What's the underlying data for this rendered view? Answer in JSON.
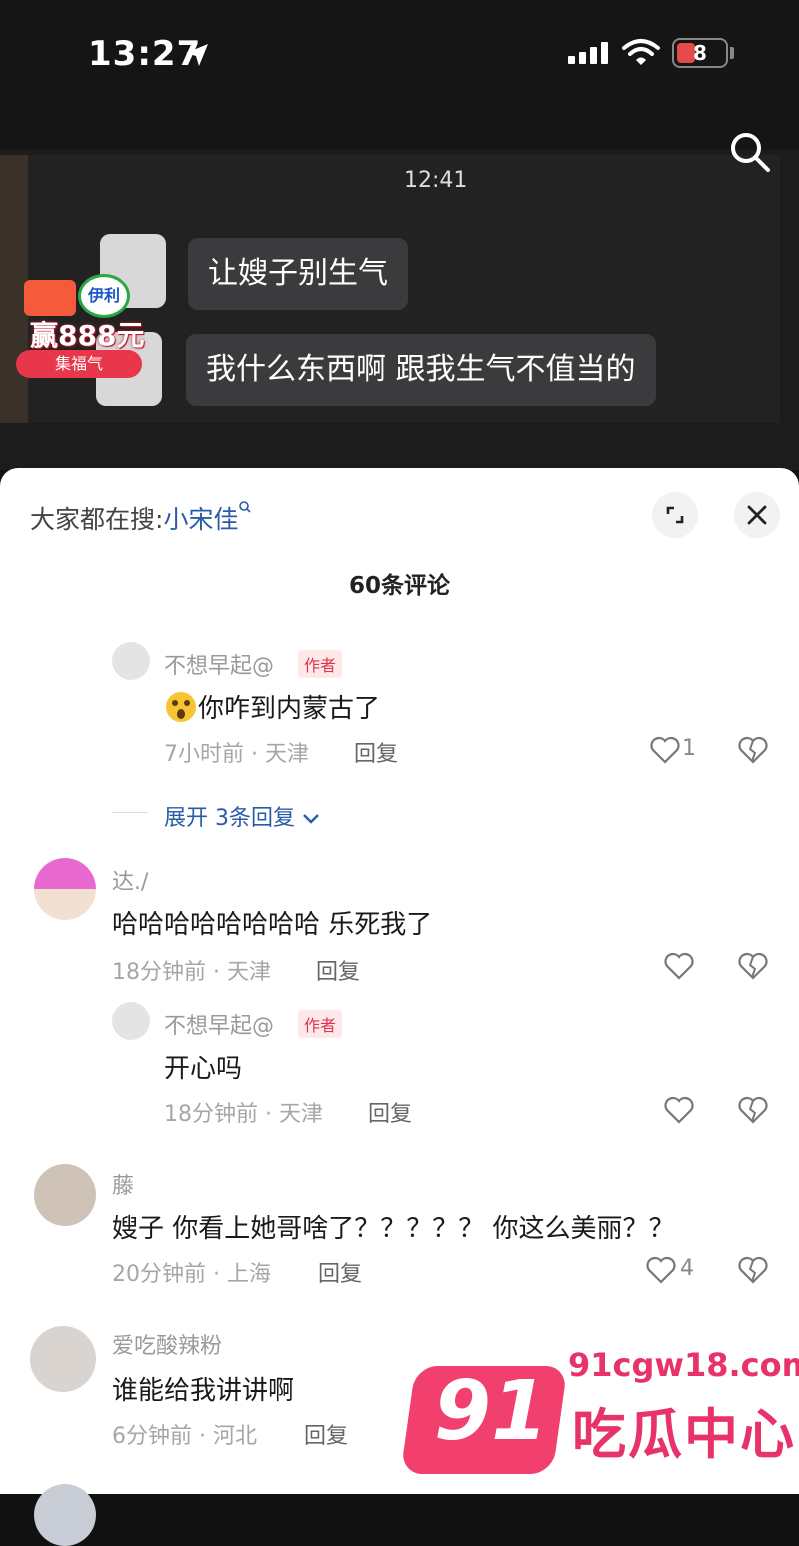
{
  "status_bar": {
    "time": "13:27",
    "battery": "8"
  },
  "video": {
    "chat_time": "12:41",
    "messages": [
      "让嫂子别生气",
      "我什么东西啊 跟我生气不值当的"
    ],
    "promo": {
      "brand": "伊利",
      "prize": "赢888元",
      "button": "集福气"
    }
  },
  "sheet": {
    "hot_search_label": "大家都在搜:",
    "hot_search_keyword": "小宋佳",
    "comment_count": "60条评论",
    "author_tag": "作者",
    "reply_label": "回复",
    "expand_replies": "展开 3条回复"
  },
  "comments": [
    {
      "user": "不想早起@",
      "text": "你咋到内蒙古了",
      "meta": "7小时前 · 天津",
      "likes": "1"
    },
    {
      "user": "达./",
      "text": "哈哈哈哈哈哈哈哈 乐死我了",
      "meta": "18分钟前 · 天津",
      "likes": ""
    },
    {
      "user": "不想早起@",
      "text": "开心吗",
      "meta": "18分钟前 · 天津",
      "likes": ""
    },
    {
      "user": "藤",
      "text": "嫂子 你看上她哥啥了？？？？？ 你这么美丽？？",
      "meta": "20分钟前 · 上海",
      "likes": "4"
    },
    {
      "user": "爱吃酸辣粉",
      "text": "谁能给我讲讲啊",
      "meta": "6分钟前 · 河北",
      "likes": ""
    }
  ],
  "watermark": {
    "number": "91",
    "url": "91cgw18.com",
    "name": "吃瓜中心"
  }
}
